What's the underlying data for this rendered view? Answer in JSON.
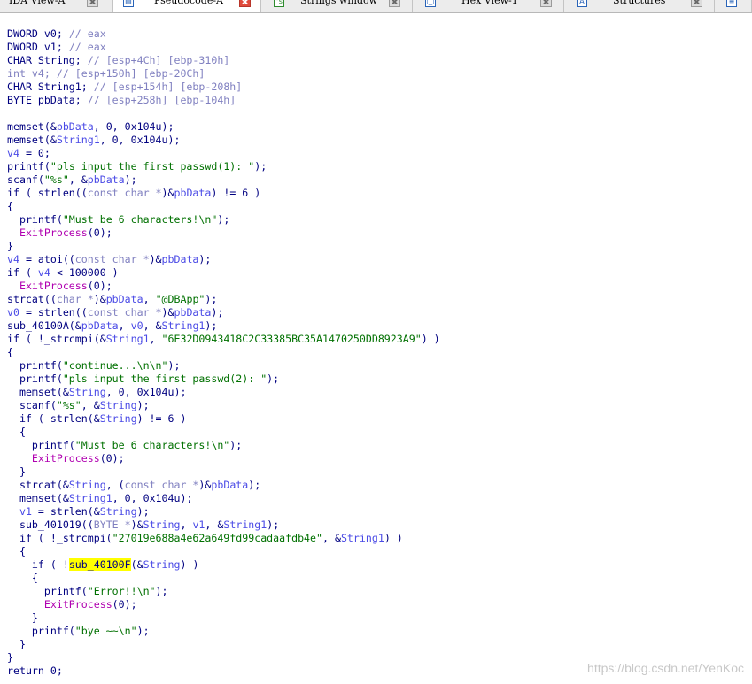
{
  "tabs": [
    {
      "label": "IDA View-A",
      "icon": "ida-view-icon",
      "glyph": "",
      "active": false
    },
    {
      "label": "Pseudocode-A",
      "icon": "pseudocode-icon",
      "glyph": "▤",
      "active": true
    },
    {
      "label": "Strings window",
      "icon": "strings-icon",
      "glyph": "\"s",
      "active": false
    },
    {
      "label": "Hex View-1",
      "icon": "hex-view-icon",
      "glyph": "◯",
      "active": false
    },
    {
      "label": "Structures",
      "icon": "structures-icon",
      "glyph": "A",
      "active": false
    },
    {
      "label": "",
      "icon": "enums-icon",
      "glyph": "≡",
      "active": false
    }
  ],
  "colors": {
    "keyword": "#000080",
    "comment": "#8080c0",
    "variable": "#4a4ae6",
    "function": "#b000b0",
    "string": "#007000",
    "highlight": "#ffff00"
  },
  "code_lines": [
    [
      [
        "plain",
        "DWORD v0; "
      ],
      [
        "comment",
        "// eax"
      ]
    ],
    [
      [
        "plain",
        "DWORD v1; "
      ],
      [
        "comment",
        "// eax"
      ]
    ],
    [
      [
        "plain",
        "CHAR String; "
      ],
      [
        "comment",
        "// [esp+4Ch] [ebp-310h]"
      ]
    ],
    [
      [
        "gray",
        "int v4; "
      ],
      [
        "comment",
        "// [esp+150h] [ebp-20Ch]"
      ]
    ],
    [
      [
        "plain",
        "CHAR String1; "
      ],
      [
        "comment",
        "// [esp+154h] [ebp-208h]"
      ]
    ],
    [
      [
        "plain",
        "BYTE pbData; "
      ],
      [
        "comment",
        "// [esp+258h] [ebp-104h]"
      ]
    ],
    [],
    [
      [
        "plain",
        "memset(&"
      ],
      [
        "var",
        "pbData"
      ],
      [
        "plain",
        ", 0, 0x104u);"
      ]
    ],
    [
      [
        "plain",
        "memset(&"
      ],
      [
        "var",
        "String1"
      ],
      [
        "plain",
        ", 0, 0x104u);"
      ]
    ],
    [
      [
        "var",
        "v4"
      ],
      [
        "plain",
        " = 0;"
      ]
    ],
    [
      [
        "plain",
        "printf("
      ],
      [
        "str",
        "\"pls input the first passwd(1): \""
      ],
      [
        "plain",
        ");"
      ]
    ],
    [
      [
        "plain",
        "scanf("
      ],
      [
        "str",
        "\"%s\""
      ],
      [
        "plain",
        ", &"
      ],
      [
        "var",
        "pbData"
      ],
      [
        "plain",
        ");"
      ]
    ],
    [
      [
        "plain",
        "if ( strlen(("
      ],
      [
        "gray",
        "const char *"
      ],
      [
        "plain",
        ")&"
      ],
      [
        "var",
        "pbData"
      ],
      [
        "plain",
        ") != 6 )"
      ]
    ],
    [
      [
        "plain",
        "{"
      ]
    ],
    [
      [
        "plain",
        "  printf("
      ],
      [
        "str",
        "\"Must be 6 characters!\\n\""
      ],
      [
        "plain",
        ");"
      ]
    ],
    [
      [
        "plain",
        "  "
      ],
      [
        "func",
        "ExitProcess"
      ],
      [
        "plain",
        "(0);"
      ]
    ],
    [
      [
        "plain",
        "}"
      ]
    ],
    [
      [
        "var",
        "v4"
      ],
      [
        "plain",
        " = atoi(("
      ],
      [
        "gray",
        "const char *"
      ],
      [
        "plain",
        ")&"
      ],
      [
        "var",
        "pbData"
      ],
      [
        "plain",
        ");"
      ]
    ],
    [
      [
        "plain",
        "if ( "
      ],
      [
        "var",
        "v4"
      ],
      [
        "plain",
        " < 100000 )"
      ]
    ],
    [
      [
        "plain",
        "  "
      ],
      [
        "func",
        "ExitProcess"
      ],
      [
        "plain",
        "(0);"
      ]
    ],
    [
      [
        "plain",
        "strcat(("
      ],
      [
        "gray",
        "char *"
      ],
      [
        "plain",
        ")&"
      ],
      [
        "var",
        "pbData"
      ],
      [
        "plain",
        ", "
      ],
      [
        "str",
        "\"@DBApp\""
      ],
      [
        "plain",
        ");"
      ]
    ],
    [
      [
        "var",
        "v0"
      ],
      [
        "plain",
        " = strlen(("
      ],
      [
        "gray",
        "const char *"
      ],
      [
        "plain",
        ")&"
      ],
      [
        "var",
        "pbData"
      ],
      [
        "plain",
        ");"
      ]
    ],
    [
      [
        "plain",
        "sub_40100A(&"
      ],
      [
        "var",
        "pbData"
      ],
      [
        "plain",
        ", "
      ],
      [
        "var",
        "v0"
      ],
      [
        "plain",
        ", &"
      ],
      [
        "var",
        "String1"
      ],
      [
        "plain",
        ");"
      ]
    ],
    [
      [
        "plain",
        "if ( !_strcmpi(&"
      ],
      [
        "var",
        "String1"
      ],
      [
        "plain",
        ", "
      ],
      [
        "str",
        "\"6E32D0943418C2C33385BC35A1470250DD8923A9\""
      ],
      [
        "plain",
        ") )"
      ]
    ],
    [
      [
        "plain",
        "{"
      ]
    ],
    [
      [
        "plain",
        "  printf("
      ],
      [
        "str",
        "\"continue...\\n\\n\""
      ],
      [
        "plain",
        ");"
      ]
    ],
    [
      [
        "plain",
        "  printf("
      ],
      [
        "str",
        "\"pls input the first passwd(2): \""
      ],
      [
        "plain",
        ");"
      ]
    ],
    [
      [
        "plain",
        "  memset(&"
      ],
      [
        "var",
        "String"
      ],
      [
        "plain",
        ", 0, 0x104u);"
      ]
    ],
    [
      [
        "plain",
        "  scanf("
      ],
      [
        "str",
        "\"%s\""
      ],
      [
        "plain",
        ", &"
      ],
      [
        "var",
        "String"
      ],
      [
        "plain",
        ");"
      ]
    ],
    [
      [
        "plain",
        "  if ( strlen(&"
      ],
      [
        "var",
        "String"
      ],
      [
        "plain",
        ") != 6 )"
      ]
    ],
    [
      [
        "plain",
        "  {"
      ]
    ],
    [
      [
        "plain",
        "    printf("
      ],
      [
        "str",
        "\"Must be 6 characters!\\n\""
      ],
      [
        "plain",
        ");"
      ]
    ],
    [
      [
        "plain",
        "    "
      ],
      [
        "func",
        "ExitProcess"
      ],
      [
        "plain",
        "(0);"
      ]
    ],
    [
      [
        "plain",
        "  }"
      ]
    ],
    [
      [
        "plain",
        "  strcat(&"
      ],
      [
        "var",
        "String"
      ],
      [
        "plain",
        ", ("
      ],
      [
        "gray",
        "const char *"
      ],
      [
        "plain",
        ")&"
      ],
      [
        "var",
        "pbData"
      ],
      [
        "plain",
        ");"
      ]
    ],
    [
      [
        "plain",
        "  memset(&"
      ],
      [
        "var",
        "String1"
      ],
      [
        "plain",
        ", 0, 0x104u);"
      ]
    ],
    [
      [
        "plain",
        "  "
      ],
      [
        "var",
        "v1"
      ],
      [
        "plain",
        " = strlen(&"
      ],
      [
        "var",
        "String"
      ],
      [
        "plain",
        ");"
      ]
    ],
    [
      [
        "plain",
        "  sub_401019(("
      ],
      [
        "gray",
        "BYTE *"
      ],
      [
        "plain",
        ")&"
      ],
      [
        "var",
        "String"
      ],
      [
        "plain",
        ", "
      ],
      [
        "var",
        "v1"
      ],
      [
        "plain",
        ", &"
      ],
      [
        "var",
        "String1"
      ],
      [
        "plain",
        ");"
      ]
    ],
    [
      [
        "plain",
        "  if ( !_strcmpi("
      ],
      [
        "str",
        "\"27019e688a4e62a649fd99cadaafdb4e\""
      ],
      [
        "plain",
        ", &"
      ],
      [
        "var",
        "String1"
      ],
      [
        "plain",
        ") )"
      ]
    ],
    [
      [
        "plain",
        "  {"
      ]
    ],
    [
      [
        "plain",
        "    if ( !"
      ],
      [
        "hl",
        "sub_40100F"
      ],
      [
        "plain",
        "(&"
      ],
      [
        "var",
        "String"
      ],
      [
        "plain",
        ") )"
      ]
    ],
    [
      [
        "plain",
        "    {"
      ]
    ],
    [
      [
        "plain",
        "      printf("
      ],
      [
        "str",
        "\"Error!!\\n\""
      ],
      [
        "plain",
        ");"
      ]
    ],
    [
      [
        "plain",
        "      "
      ],
      [
        "func",
        "ExitProcess"
      ],
      [
        "plain",
        "(0);"
      ]
    ],
    [
      [
        "plain",
        "    }"
      ]
    ],
    [
      [
        "plain",
        "    printf("
      ],
      [
        "str",
        "\"bye ~~\\n\""
      ],
      [
        "plain",
        ");"
      ]
    ],
    [
      [
        "plain",
        "  }"
      ]
    ],
    [
      [
        "plain",
        "}"
      ]
    ],
    [
      [
        "plain",
        "return 0;"
      ]
    ]
  ],
  "watermark": "https://blog.csdn.net/YenKoc"
}
